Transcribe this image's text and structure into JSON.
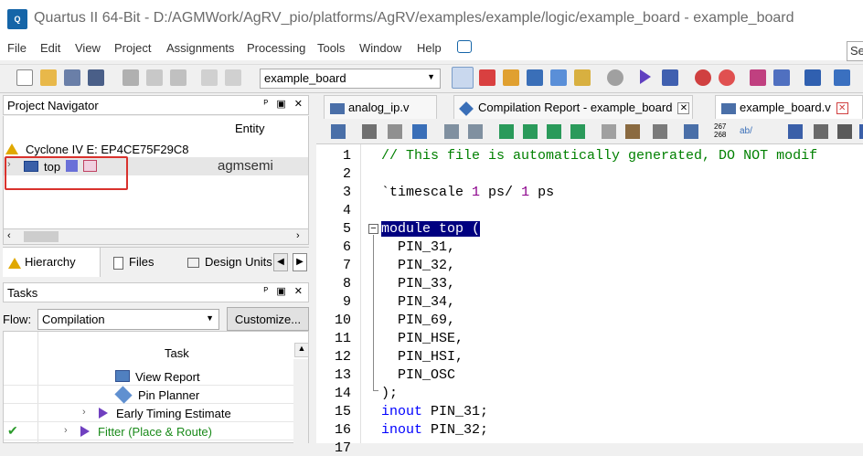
{
  "window": {
    "title": "Quartus II 64-Bit - D:/AGMWork/AgRV_pio/platforms/AgRV/examples/example/logic/example_board - example_board"
  },
  "menu": [
    "File",
    "Edit",
    "View",
    "Project",
    "Assignments",
    "Processing",
    "Tools",
    "Window",
    "Help"
  ],
  "menu_search_placeholder": "Se",
  "toolbar": {
    "revision": "example_board"
  },
  "project_navigator": {
    "title": "Project Navigator",
    "column_header": "Entity",
    "device": "Cyclone IV E: EP4CE75F29C8",
    "top_entity": "top",
    "top_entity_owner": "agmsemi",
    "tabs": [
      "Hierarchy",
      "Files",
      "Design Units"
    ]
  },
  "tasks": {
    "title": "Tasks",
    "flow_label": "Flow:",
    "flow_value": "Compilation",
    "customize_label": "Customize...",
    "column_header": "Task",
    "rows": [
      {
        "label": "View Report",
        "status": ""
      },
      {
        "label": "Pin Planner",
        "status": ""
      },
      {
        "label": "Early Timing Estimate",
        "status": ""
      },
      {
        "label": "Fitter (Place & Route)",
        "status": "✔"
      }
    ]
  },
  "doc_tabs": [
    {
      "label": "analog_ip.v"
    },
    {
      "label": "Compilation Report - example_board"
    },
    {
      "label": "example_board.v"
    }
  ],
  "editor_toolbar_labels": {
    "numbers": "267\n268",
    "ab": "ab/"
  },
  "editor": {
    "line_numbers": [
      "1",
      "2",
      "3",
      "4",
      "5",
      "6",
      "7",
      "8",
      "9",
      "10",
      "11",
      "12",
      "13",
      "14",
      "15",
      "16",
      "17"
    ],
    "lines": [
      "// This file is automatically generated, DO NOT modif",
      "",
      "`timescale 1 ps/ 1 ps",
      "",
      "module top (",
      "  PIN_31,",
      "  PIN_32,",
      "  PIN_33,",
      "  PIN_34,",
      "  PIN_69,",
      "  PIN_HSE,",
      "  PIN_HSI,",
      "  PIN_OSC",
      ");",
      "inout PIN_31;",
      "inout PIN_32;",
      ""
    ]
  },
  "colors": {
    "keyword": "#0000ff",
    "comment": "#008000",
    "number": "#8b008b",
    "highlight": "#000080",
    "annotation_box": "#d9322d"
  }
}
